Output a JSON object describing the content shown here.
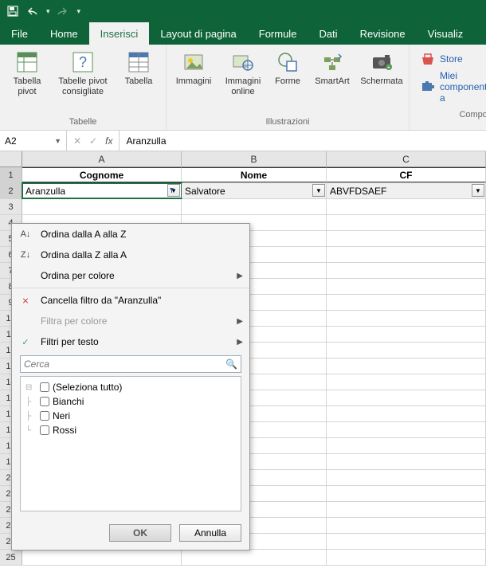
{
  "qat": {
    "save": "save",
    "undo": "undo",
    "redo": "redo"
  },
  "menu": {
    "file": "File",
    "home": "Home",
    "insert": "Inserisci",
    "layout": "Layout di pagina",
    "formulas": "Formule",
    "data": "Dati",
    "review": "Revisione",
    "view": "Visualiz"
  },
  "ribbon": {
    "tables": {
      "pivot": "Tabella pivot",
      "recommended": "Tabelle pivot consigliate",
      "table": "Tabella",
      "group": "Tabelle"
    },
    "illus": {
      "images": "Immagini",
      "online": "Immagini online",
      "shapes": "Forme",
      "smartart": "SmartArt",
      "screenshot": "Schermata",
      "group": "Illustrazioni"
    },
    "addins": {
      "store": "Store",
      "my": "Miei componenti a",
      "group": "Compon"
    }
  },
  "formula_bar": {
    "ref": "A2",
    "fx": "fx",
    "value": "Aranzulla"
  },
  "columns": {
    "A": "A",
    "B": "B",
    "C": "C"
  },
  "headers": {
    "A": "Cognome",
    "B": "Nome",
    "C": "CF"
  },
  "row2": {
    "A": "Aranzulla",
    "B": "Salvatore",
    "C": "ABVFDSAEF"
  },
  "filter": {
    "sort_az": "Ordina dalla A alla Z",
    "sort_za": "Ordina dalla Z alla A",
    "sort_color": "Ordina per colore",
    "clear": "Cancella filtro da \"Aranzulla\"",
    "filter_color": "Filtra per colore",
    "text_filters": "Filtri per testo",
    "search_ph": "Cerca",
    "select_all": "(Seleziona tutto)",
    "items": [
      "Bianchi",
      "Neri",
      "Rossi"
    ],
    "ok": "OK",
    "cancel": "Annulla"
  }
}
